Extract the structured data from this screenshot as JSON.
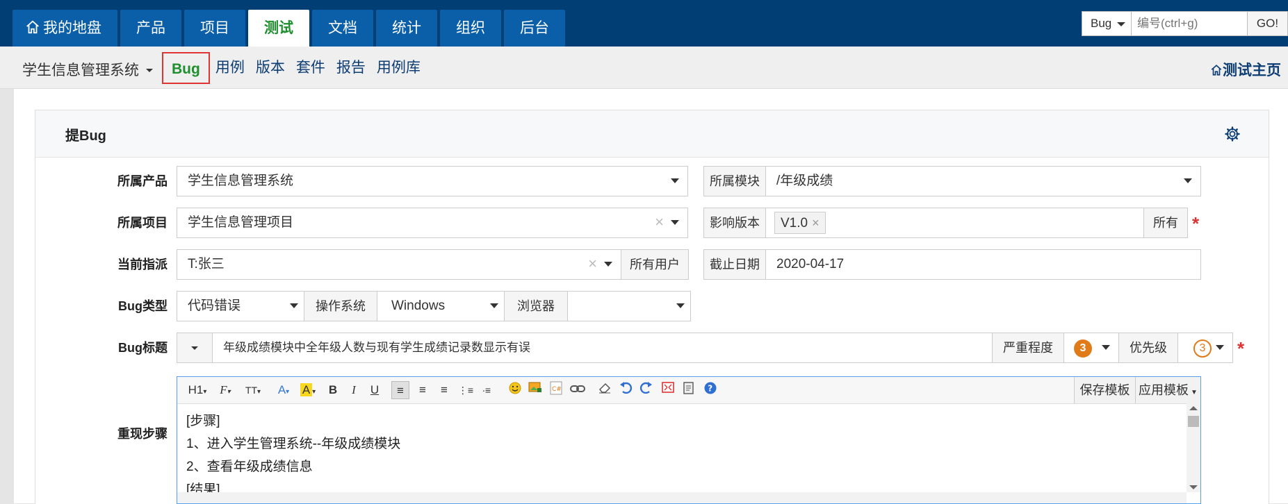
{
  "topnav": {
    "tabs": [
      {
        "label": "我的地盘",
        "icon": "home-icon"
      },
      {
        "label": "产品"
      },
      {
        "label": "项目"
      },
      {
        "label": "测试",
        "active": true
      },
      {
        "label": "文档"
      },
      {
        "label": "统计"
      },
      {
        "label": "组织"
      },
      {
        "label": "后台"
      }
    ],
    "search": {
      "type": "Bug",
      "placeholder": "编号(ctrl+g)",
      "go": "GO!"
    }
  },
  "subnav": {
    "product": "学生信息管理系统",
    "items": [
      "Bug",
      "用例",
      "版本",
      "套件",
      "报告",
      "用例库"
    ],
    "active": "Bug",
    "home": "测试主页"
  },
  "panel": {
    "title": "提Bug"
  },
  "form": {
    "product": {
      "label": "所属产品",
      "value": "学生信息管理系统"
    },
    "module": {
      "label": "所属模块",
      "value": "/年级成绩"
    },
    "project": {
      "label": "所属项目",
      "value": "学生信息管理项目"
    },
    "build": {
      "label": "影响版本",
      "tag": "V1.0",
      "tag_remove": "×",
      "all": "所有"
    },
    "assign": {
      "label": "当前指派",
      "value": "T:张三",
      "all_users": "所有用户"
    },
    "deadline": {
      "label": "截止日期",
      "value": "2020-04-17"
    },
    "type": {
      "label": "Bug类型",
      "value": "代码错误"
    },
    "os": {
      "label": "操作系统",
      "value": "Windows"
    },
    "browser": {
      "label": "浏览器",
      "value": ""
    },
    "title": {
      "label": "Bug标题",
      "value": "年级成绩模块中全年级人数与现有学生成绩记录数显示有误"
    },
    "severity": {
      "label": "严重程度",
      "value": "3"
    },
    "priority": {
      "label": "优先级",
      "value": "3"
    },
    "steps": {
      "label": "重现步骤",
      "lines": [
        "[步骤]",
        "1、进入学生管理系统--年级成绩模块",
        "2、查看年级成绩信息",
        "[结果]"
      ]
    },
    "required_mark": "*",
    "clear_mark": "×"
  },
  "editor": {
    "toolbar": [
      "H1",
      "F",
      "TT",
      "A",
      "A",
      "B",
      "I",
      "U"
    ],
    "save_template": "保存模板",
    "apply_template": "应用模板"
  }
}
